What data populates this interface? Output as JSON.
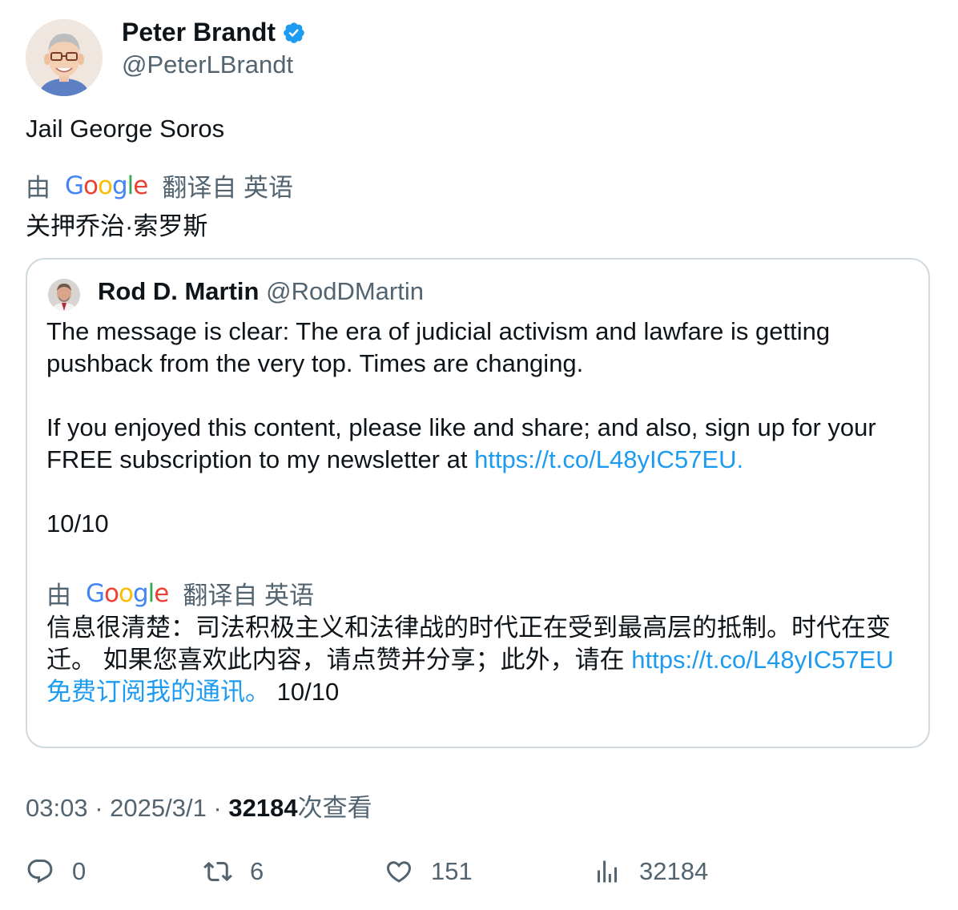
{
  "author": {
    "name": "Peter Brandt",
    "handle": "@PeterLBrandt",
    "verified_color": "#1d9bf0"
  },
  "tweet": {
    "text": "Jail George Soros",
    "translation_prefix": "由",
    "translation_logo": "Google",
    "translation_suffix": "翻译自 英语",
    "translated_text": "关押乔治·索罗斯"
  },
  "quote": {
    "name": "Rod D. Martin",
    "handle": "@RodDMartin",
    "paragraph1": "The message is clear: The era of judicial activism and lawfare is getting pushback from the very top. Times are changing.",
    "paragraph2_text": "If you enjoyed this content, please like and share; and also, sign up for your FREE subscription to my newsletter at ",
    "paragraph2_link": "https://t.co/L48yIC57EU.",
    "paragraph3": "10/10",
    "translation_prefix": "由",
    "translation_logo": "Google",
    "translation_suffix": "翻译自 英语",
    "translated_text_1": "信息很清楚：司法积极主义和法律战的时代正在受到最高层的抵制。时代在变迁。 如果您喜欢此内容，请点赞并分享；此外，请在 ",
    "translated_link": "https://t.co/L48yIC57EU免费订阅我的通讯。",
    "translated_text_2": " 10/10"
  },
  "meta": {
    "time": "03:03",
    "separator": " · ",
    "date": "2025/3/1",
    "views_count": "32184",
    "views_label": "次查看"
  },
  "actions": {
    "replies": "0",
    "retweets": "6",
    "likes": "151",
    "views": "32184"
  },
  "colors": {
    "link": "#1d9bf0",
    "secondary_text": "#536471",
    "border": "#cfd9de"
  }
}
